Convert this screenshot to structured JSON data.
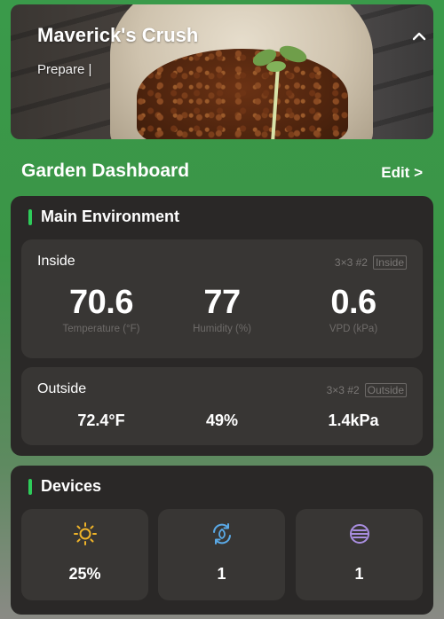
{
  "plant": {
    "name": "Maverick's Crush",
    "stage": "Prepare |"
  },
  "dashboard": {
    "title": "Garden Dashboard",
    "edit_label": "Edit >"
  },
  "environment": {
    "title": "Main Environment",
    "inside": {
      "label": "Inside",
      "tent": "3×3 #2",
      "tag": "Inside",
      "temperature": "70.6",
      "temperature_caption": "Temperature (°F)",
      "humidity": "77",
      "humidity_caption": "Humidity (%)",
      "vpd": "0.6",
      "vpd_caption": "VPD (kPa)"
    },
    "outside": {
      "label": "Outside",
      "tent": "3×3 #2",
      "tag": "Outside",
      "temperature": "72.4°F",
      "humidity": "49%",
      "vpd": "1.4kPa"
    }
  },
  "devices": {
    "title": "Devices",
    "items": [
      {
        "icon": "sun-icon",
        "value": "25%",
        "color": "#f0b429"
      },
      {
        "icon": "fan-cycle-icon",
        "value": "1",
        "color": "#5aa9e6"
      },
      {
        "icon": "filter-icon",
        "value": "1",
        "color": "#a98ee0"
      }
    ]
  },
  "colors": {
    "accent": "#2ecc5a",
    "background_top": "#3a9a4a",
    "panel": "#2a2827",
    "subcard": "#383634"
  }
}
